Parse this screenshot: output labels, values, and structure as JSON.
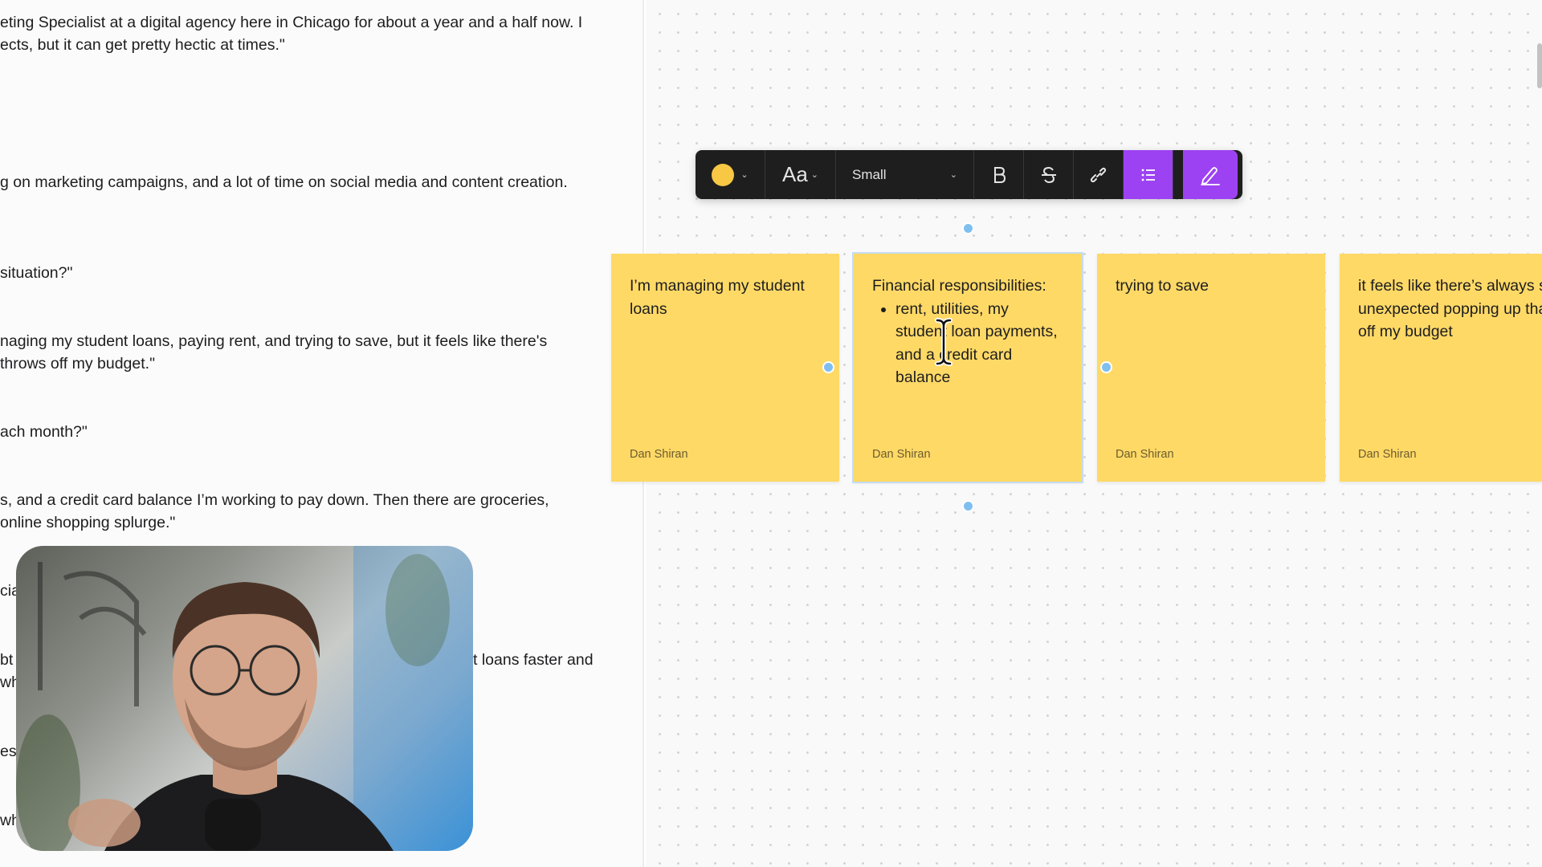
{
  "transcript": {
    "lines": [
      "eting Specialist at a digital agency here in Chicago for about a year and a half now. I",
      "ects, but it can get pretty hectic at times.\"",
      "g on marketing campaigns, and a lot of time on social media and content creation.",
      " situation?\"",
      "naging my student loans, paying rent, and trying to save, but it feels like there's",
      " throws off my budget.\"",
      "ach month?\"",
      "s, and a credit card balance I’m working to pay down. Then there are groceries,",
      "online shopping splurge.\"",
      "cia",
      "bt",
      "t loans faster and",
      "wh",
      "ese",
      "wh"
    ]
  },
  "toolbar": {
    "color": "#f8c744",
    "font_label": "Aa",
    "size_value": "Small",
    "accent": "#9d42f2",
    "icons": [
      "bold-icon",
      "strikethrough-icon",
      "link-icon",
      "bullet-list-icon",
      "pen-icon"
    ]
  },
  "stickies": [
    {
      "text": "I’m managing my student loans",
      "author": "Dan Shiran"
    },
    {
      "heading": "Financial responsibilities:",
      "bullets": [
        "rent, utilities, my student loan payments, and a credit card balance"
      ],
      "author": "Dan Shiran"
    },
    {
      "text": "trying to save",
      "author": "Dan Shiran"
    },
    {
      "text": "it feels like there’s always something unexpected popping up that throws off my budget",
      "author": "Dan Shiran"
    }
  ]
}
